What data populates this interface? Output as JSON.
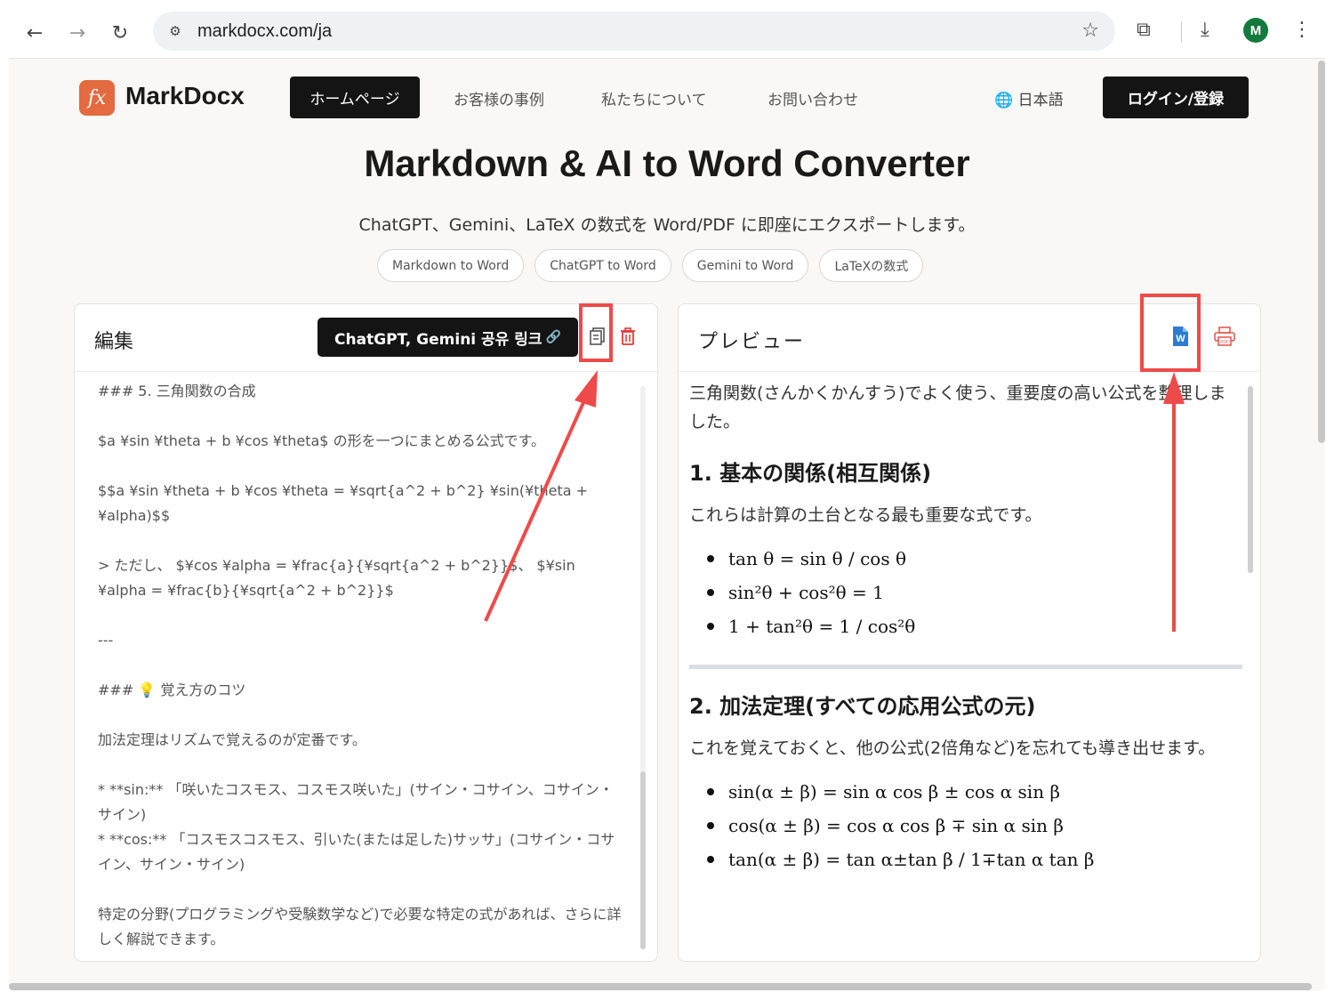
{
  "browser": {
    "url": "markdocx.com/ja",
    "avatar_letter": "M"
  },
  "header": {
    "logo_glyph": "fx",
    "logo_text": "MarkDocx",
    "nav": [
      "ホームページ",
      "お客様の事例",
      "私たちについて",
      "お問い合わせ"
    ],
    "language": "日本語",
    "login": "ログイン/登録"
  },
  "hero": {
    "title": "Markdown & AI to Word Converter",
    "subtitle": "ChatGPT、Gemini、LaTeX の数式を Word/PDF に即座にエクスポートします。",
    "pills": [
      "Markdown to Word",
      "ChatGPT to Word",
      "Gemini to Word",
      "LaTeXの数式"
    ]
  },
  "editor": {
    "title": "編集",
    "share_button": "ChatGPT, Gemini 공유 링크",
    "lines": [
      "### 5. 三角関数の合成",
      "$a ¥sin ¥theta + b ¥cos ¥theta$ の形を一つにまとめる公式です。",
      "$$a ¥sin ¥theta + b ¥cos ¥theta = ¥sqrt{a^2 + b^2} ¥sin(¥theta + ¥alpha)$$",
      "> ただし、 $¥cos ¥alpha = ¥frac{a}{¥sqrt{a^2 + b^2}}$、 $¥sin ¥alpha = ¥frac{b}{¥sqrt{a^2 + b^2}}$",
      "---",
      "### 💡 覚え方のコツ",
      "加法定理はリズムで覚えるのが定番です。",
      "* **sin:** 「咲いたコスモス、コスモス咲いた」(サイン・コサイン、コサイン・サイン)",
      "* **cos:** 「コスモスコスモス、引いた(または足した)サッサ」(コサイン・コサイン、サイン・サイン)",
      "特定の分野(プログラミングや受験数学など)で必要な特定の式があれば、さらに詳しく解説できます。"
    ]
  },
  "preview": {
    "title": "プレビュー",
    "intro": "三角関数(さんかくかんすう)でよく使う、重要度の高い公式を整理しました。",
    "section1_title": "1. 基本の関係(相互関係)",
    "section1_text": "これらは計算の土台となる最も重要な式です。",
    "section1_formulas": [
      "tan θ = sin θ / cos θ",
      "sin²θ + cos²θ = 1",
      "1 + tan²θ = 1 / cos²θ"
    ],
    "section2_title": "2. 加法定理(すべての応用公式の元)",
    "section2_text": "これを覚えておくと、他の公式(2倍角など)を忘れても導き出せます。",
    "section2_formulas": [
      "sin(α ± β) = sin α cos β ± cos α sin β",
      "cos(α ± β) = cos α cos β ∓ sin α sin β",
      "tan(α ± β) = tan α±tan β / 1∓tan α tan β"
    ]
  },
  "colors": {
    "accent_red": "#ef4a4a",
    "word_blue": "#2b7cd3",
    "logo_orange": "#e46a3f"
  }
}
